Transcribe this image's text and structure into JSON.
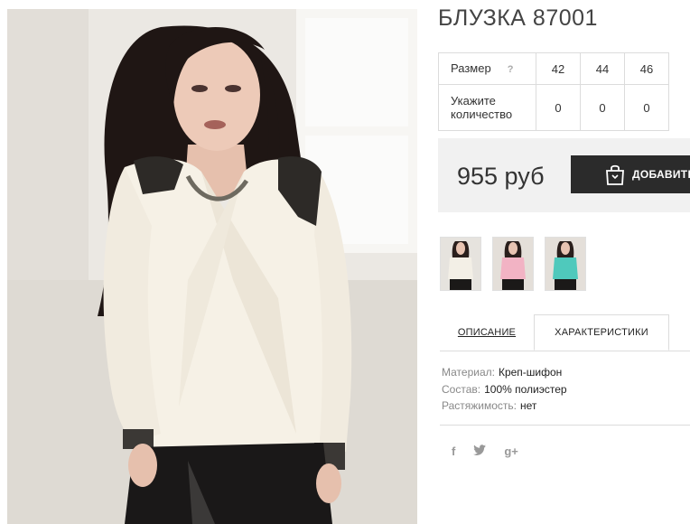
{
  "product": {
    "title": "БЛУЗКА 87001",
    "main_image": "product-photo"
  },
  "size_table": {
    "size_label": "Размер",
    "help_icon": "?",
    "sizes": [
      "42",
      "44",
      "46"
    ],
    "quantity_label": "Укажите количество",
    "quantities": [
      "0",
      "0",
      "0"
    ]
  },
  "purchase": {
    "price": "955 руб",
    "add_to_cart_label": "ДОБАВИТЬ",
    "cart_icon": "shopping-bag-icon"
  },
  "thumbnails": [
    {
      "name": "white-blouse-thumb",
      "color": "#f3efe6"
    },
    {
      "name": "pink-blouse-thumb",
      "color": "#f2b3c4"
    },
    {
      "name": "mint-blouse-thumb",
      "color": "#4fc9bc"
    }
  ],
  "tabs": {
    "description": "ОПИСАНИЕ",
    "characteristics": "ХАРАКТЕРИСТИКИ"
  },
  "specs": [
    {
      "key": "Материал:",
      "value": "Креп-шифон"
    },
    {
      "key": "Состав:",
      "value": "100% полиэстер"
    },
    {
      "key": "Растяжимость:",
      "value": "нет"
    }
  ],
  "social": {
    "facebook": "f",
    "twitter": "twitter-icon",
    "googleplus": "g+"
  },
  "colors": {
    "button_bg": "#2b2b2b",
    "price_bg": "#f1f1f1",
    "border": "#dcdcdc"
  }
}
